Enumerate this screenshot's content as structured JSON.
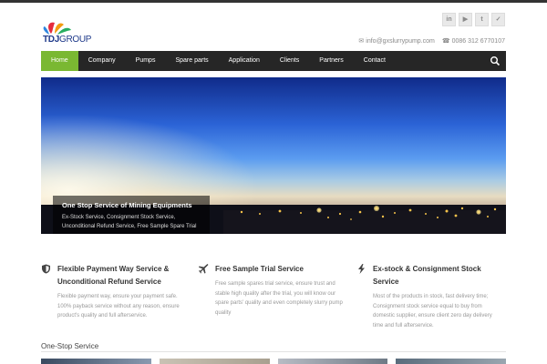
{
  "brand": {
    "name": "TDJ",
    "group": "GROUP"
  },
  "social": [
    {
      "name": "linkedin",
      "glyph": "in"
    },
    {
      "name": "youtube",
      "glyph": "▶"
    },
    {
      "name": "tumblr",
      "glyph": "t"
    },
    {
      "name": "twitter",
      "glyph": "✓"
    }
  ],
  "contact": {
    "email": "info@gxslurrypump.com",
    "phone": "0086 312 6770107"
  },
  "nav": [
    "Home",
    "Company",
    "Pumps",
    "Spare parts",
    "Application",
    "Clients",
    "Partners",
    "Contact"
  ],
  "hero": {
    "title": "One Stop Service of Mining Equipments",
    "desc": "Ex-Stock Service, Consignment Stock Service, Unconditional Refund Service, Free Sample Spare Trial"
  },
  "features": [
    {
      "icon": "shield-icon",
      "title": "Flexible Payment Way Service & Unconditional Refund Service",
      "desc": "Flexible payment way, ensure your payment safe. 100% payback service without any reason, ensure product's quality and full afterservice."
    },
    {
      "icon": "plane-icon",
      "title": "Free Sample Trial Service",
      "desc": "Free sample spares trial service, ensure trust and stable high quality after the trial, you will know our spare parts' quality and even completely slurry pump quality"
    },
    {
      "icon": "bolt-icon",
      "title": "Ex-stock & Consignment Stock Service",
      "desc": "Most of the products in stock, fast delivery time; Consignment stock service equal to buy from domestic supplier, ensure client zero day delivery time and full afterservice."
    }
  ],
  "section": {
    "title": "One-Stop Service"
  },
  "colors": {
    "nav_bg": "#262626",
    "nav_active": "#7ab832",
    "accent": "#7ab832"
  }
}
